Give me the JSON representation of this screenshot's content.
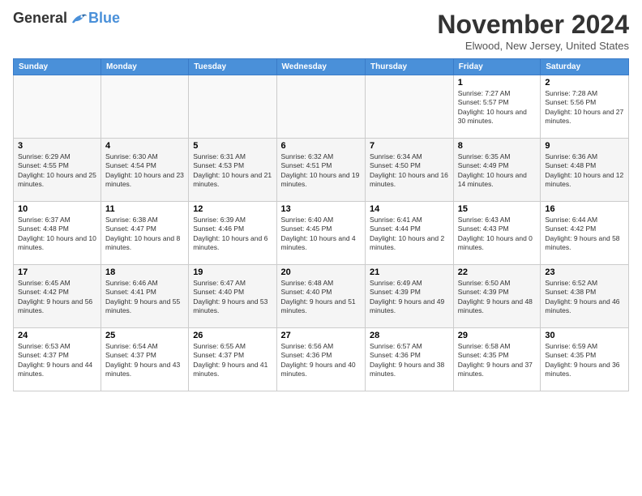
{
  "logo": {
    "general": "General",
    "blue": "Blue"
  },
  "title": "November 2024",
  "location": "Elwood, New Jersey, United States",
  "days_header": [
    "Sunday",
    "Monday",
    "Tuesday",
    "Wednesday",
    "Thursday",
    "Friday",
    "Saturday"
  ],
  "weeks": [
    [
      {
        "day": "",
        "info": ""
      },
      {
        "day": "",
        "info": ""
      },
      {
        "day": "",
        "info": ""
      },
      {
        "day": "",
        "info": ""
      },
      {
        "day": "",
        "info": ""
      },
      {
        "day": "1",
        "info": "Sunrise: 7:27 AM\nSunset: 5:57 PM\nDaylight: 10 hours and 30 minutes."
      },
      {
        "day": "2",
        "info": "Sunrise: 7:28 AM\nSunset: 5:56 PM\nDaylight: 10 hours and 27 minutes."
      }
    ],
    [
      {
        "day": "3",
        "info": "Sunrise: 6:29 AM\nSunset: 4:55 PM\nDaylight: 10 hours and 25 minutes."
      },
      {
        "day": "4",
        "info": "Sunrise: 6:30 AM\nSunset: 4:54 PM\nDaylight: 10 hours and 23 minutes."
      },
      {
        "day": "5",
        "info": "Sunrise: 6:31 AM\nSunset: 4:53 PM\nDaylight: 10 hours and 21 minutes."
      },
      {
        "day": "6",
        "info": "Sunrise: 6:32 AM\nSunset: 4:51 PM\nDaylight: 10 hours and 19 minutes."
      },
      {
        "day": "7",
        "info": "Sunrise: 6:34 AM\nSunset: 4:50 PM\nDaylight: 10 hours and 16 minutes."
      },
      {
        "day": "8",
        "info": "Sunrise: 6:35 AM\nSunset: 4:49 PM\nDaylight: 10 hours and 14 minutes."
      },
      {
        "day": "9",
        "info": "Sunrise: 6:36 AM\nSunset: 4:48 PM\nDaylight: 10 hours and 12 minutes."
      }
    ],
    [
      {
        "day": "10",
        "info": "Sunrise: 6:37 AM\nSunset: 4:48 PM\nDaylight: 10 hours and 10 minutes."
      },
      {
        "day": "11",
        "info": "Sunrise: 6:38 AM\nSunset: 4:47 PM\nDaylight: 10 hours and 8 minutes."
      },
      {
        "day": "12",
        "info": "Sunrise: 6:39 AM\nSunset: 4:46 PM\nDaylight: 10 hours and 6 minutes."
      },
      {
        "day": "13",
        "info": "Sunrise: 6:40 AM\nSunset: 4:45 PM\nDaylight: 10 hours and 4 minutes."
      },
      {
        "day": "14",
        "info": "Sunrise: 6:41 AM\nSunset: 4:44 PM\nDaylight: 10 hours and 2 minutes."
      },
      {
        "day": "15",
        "info": "Sunrise: 6:43 AM\nSunset: 4:43 PM\nDaylight: 10 hours and 0 minutes."
      },
      {
        "day": "16",
        "info": "Sunrise: 6:44 AM\nSunset: 4:42 PM\nDaylight: 9 hours and 58 minutes."
      }
    ],
    [
      {
        "day": "17",
        "info": "Sunrise: 6:45 AM\nSunset: 4:42 PM\nDaylight: 9 hours and 56 minutes."
      },
      {
        "day": "18",
        "info": "Sunrise: 6:46 AM\nSunset: 4:41 PM\nDaylight: 9 hours and 55 minutes."
      },
      {
        "day": "19",
        "info": "Sunrise: 6:47 AM\nSunset: 4:40 PM\nDaylight: 9 hours and 53 minutes."
      },
      {
        "day": "20",
        "info": "Sunrise: 6:48 AM\nSunset: 4:40 PM\nDaylight: 9 hours and 51 minutes."
      },
      {
        "day": "21",
        "info": "Sunrise: 6:49 AM\nSunset: 4:39 PM\nDaylight: 9 hours and 49 minutes."
      },
      {
        "day": "22",
        "info": "Sunrise: 6:50 AM\nSunset: 4:39 PM\nDaylight: 9 hours and 48 minutes."
      },
      {
        "day": "23",
        "info": "Sunrise: 6:52 AM\nSunset: 4:38 PM\nDaylight: 9 hours and 46 minutes."
      }
    ],
    [
      {
        "day": "24",
        "info": "Sunrise: 6:53 AM\nSunset: 4:37 PM\nDaylight: 9 hours and 44 minutes."
      },
      {
        "day": "25",
        "info": "Sunrise: 6:54 AM\nSunset: 4:37 PM\nDaylight: 9 hours and 43 minutes."
      },
      {
        "day": "26",
        "info": "Sunrise: 6:55 AM\nSunset: 4:37 PM\nDaylight: 9 hours and 41 minutes."
      },
      {
        "day": "27",
        "info": "Sunrise: 6:56 AM\nSunset: 4:36 PM\nDaylight: 9 hours and 40 minutes."
      },
      {
        "day": "28",
        "info": "Sunrise: 6:57 AM\nSunset: 4:36 PM\nDaylight: 9 hours and 38 minutes."
      },
      {
        "day": "29",
        "info": "Sunrise: 6:58 AM\nSunset: 4:35 PM\nDaylight: 9 hours and 37 minutes."
      },
      {
        "day": "30",
        "info": "Sunrise: 6:59 AM\nSunset: 4:35 PM\nDaylight: 9 hours and 36 minutes."
      }
    ]
  ]
}
